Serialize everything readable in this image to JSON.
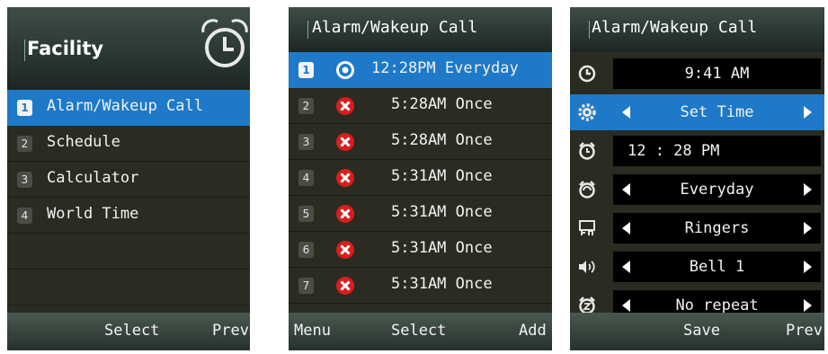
{
  "facility": {
    "title": "Facility",
    "items": [
      {
        "num": "1",
        "label": "Alarm/Wakeup Call"
      },
      {
        "num": "2",
        "label": "Schedule"
      },
      {
        "num": "3",
        "label": "Calculator"
      },
      {
        "num": "4",
        "label": "World Time"
      }
    ],
    "softkeys": {
      "center": "Select",
      "right": "Prev"
    }
  },
  "alarm_list": {
    "title": "Alarm/Wakeup Call",
    "items": [
      {
        "num": "1",
        "time": "12:28PM Everyday",
        "status": "on"
      },
      {
        "num": "2",
        "time": "5:28AM Once",
        "status": "off"
      },
      {
        "num": "3",
        "time": "5:28AM Once",
        "status": "off"
      },
      {
        "num": "4",
        "time": "5:31AM Once",
        "status": "off"
      },
      {
        "num": "5",
        "time": "5:31AM Once",
        "status": "off"
      },
      {
        "num": "6",
        "time": "5:31AM Once",
        "status": "off"
      },
      {
        "num": "7",
        "time": "5:31AM Once",
        "status": "off"
      }
    ],
    "softkeys": {
      "left": "Menu",
      "center": "Select",
      "right": "Add"
    }
  },
  "alarm_edit": {
    "title": "Alarm/Wakeup Call",
    "fields": {
      "current_time": "9:41 AM",
      "time_mode": "Set Time",
      "alarm_time": "12 : 28 PM",
      "repeat_days": "Everyday",
      "sound_type": "Ringers",
      "ringtone": "Bell 1",
      "snooze": "No repeat"
    },
    "softkeys": {
      "center": "Save",
      "right": "Prev"
    }
  },
  "colors": {
    "highlight": "#1e79c8",
    "background": "#2b2b22",
    "alarm_on": "#1e79c8",
    "alarm_off": "#d81e1e"
  }
}
